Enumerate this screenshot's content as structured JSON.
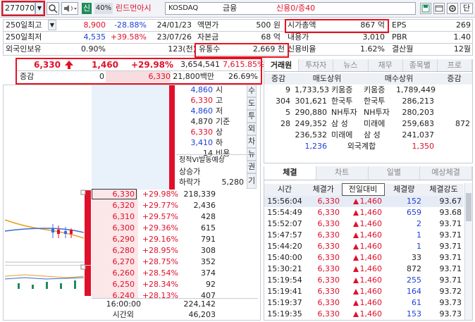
{
  "toolbar": {
    "code": "277070",
    "brand_tag": "신",
    "ratio": "40%",
    "name": "린드먼아시",
    "market": "KOSDAQ",
    "sector": "금융",
    "credit": "신용0/증40",
    "single": "단"
  },
  "info": {
    "r1": {
      "l1": "250일최고",
      "v1": "8,900",
      "p1": "-28.88%",
      "d1": "24/01/23",
      "l2": "액면가",
      "v2": "500 원",
      "l3": "시가총액",
      "v3": "867 억",
      "l4": "EPS",
      "v4": "269"
    },
    "r2": {
      "l1": "250일최저",
      "v1": "4,535",
      "p1": "+39.58%",
      "d1": "23/07/26",
      "l2": "자본금",
      "v2": "68 억",
      "l3": "내용가",
      "v3": "3,010",
      "l4": "PBR",
      "v4": "1.40"
    },
    "r3": {
      "l1": "외국인보유",
      "v1": "0.90%",
      "p1": "123(천)",
      "l2": "유통수",
      "v2": "2,669 천",
      "l3": "신용비율",
      "v3": "1.62%",
      "l4": "결산월",
      "v4": "12월"
    }
  },
  "price": {
    "current": "6,330",
    "change": "1,460",
    "rate": "+29.98%",
    "volume": "3,654,541",
    "vol_rate": "7,615.85%",
    "cmp_label": "증감",
    "cmp_val": "0",
    "cmp_price": "6,330",
    "amount": "21,800백만",
    "turnover": "26.69%"
  },
  "summary": [
    {
      "val": "4,860",
      "label": "시",
      "color": "blue"
    },
    {
      "val": "6,330",
      "label": "고",
      "color": "red"
    },
    {
      "val": "4,860",
      "label": "저",
      "color": "blue"
    },
    {
      "val": "4,870",
      "label": "기준",
      "color": "black"
    },
    {
      "val": "6,330",
      "label": "상",
      "color": "red"
    },
    {
      "val": "3,410",
      "label": "하",
      "color": "blue"
    },
    {
      "val": "14",
      "label": "비용",
      "color": "black"
    }
  ],
  "static_vi": {
    "title": "정적VI발동예상",
    "upper_label": "상승가",
    "lower_label": "하락가",
    "lower_val": "5,280"
  },
  "vbuttons": [
    "수",
    "도",
    "투",
    "외",
    "차",
    "뉴",
    "권",
    "기"
  ],
  "book": {
    "asks": [
      {
        "price": "6,330",
        "rate": "+29.98%",
        "qty": "218,339"
      },
      {
        "price": "6,320",
        "rate": "+29.77%",
        "qty": "2,436"
      },
      {
        "price": "6,310",
        "rate": "+29.57%",
        "qty": "428"
      },
      {
        "price": "6,300",
        "rate": "+29.36%",
        "qty": "615"
      },
      {
        "price": "6,290",
        "rate": "+29.16%",
        "qty": "791"
      },
      {
        "price": "6,280",
        "rate": "+28.95%",
        "qty": "308"
      },
      {
        "price": "6,270",
        "rate": "+28.75%",
        "qty": "352"
      },
      {
        "price": "6,260",
        "rate": "+28.54%",
        "qty": "374"
      },
      {
        "price": "6,250",
        "rate": "+28.34%",
        "qty": "92"
      },
      {
        "price": "6,240",
        "rate": "+28.13%",
        "qty": "407"
      }
    ],
    "foot": {
      "time": "16:00:00",
      "time_qty": "224,142",
      "after_label": "시간외",
      "after_qty": "46,203"
    }
  },
  "broker": {
    "tabs": [
      "거래원",
      "투자자",
      "뉴스",
      "재무",
      "종목별",
      "프로"
    ],
    "header": [
      "증감",
      "매도상위",
      "매수상위",
      "증감"
    ],
    "rows": [
      {
        "d1": "9",
        "sv": "1,733,531",
        "sn": "키움증",
        "bn": "키움증",
        "bv": "1,789,449",
        "d2": ""
      },
      {
        "d1": "304",
        "sv": "301,621",
        "sn": "한국투",
        "bn": "한국투",
        "bv": "286,213",
        "d2": ""
      },
      {
        "d1": "5",
        "sv": "290,880",
        "sn": "NH투자",
        "bn": "NH투자",
        "bv": "280,203",
        "d2": ""
      },
      {
        "d1": "28",
        "sv": "249,352",
        "sn": "삼  성",
        "bn": "미래에",
        "bv": "259,683",
        "d2": "872"
      },
      {
        "d1": "",
        "sv": "236,532",
        "sn": "미래에",
        "bn": "삼  성",
        "bv": "241,037",
        "d2": ""
      }
    ],
    "foreign": {
      "left": "1,236",
      "label": "외국계합",
      "right": "1,350"
    }
  },
  "trades": {
    "tabs": [
      "체결",
      "차트",
      "일별",
      "예상체결"
    ],
    "header": [
      "시간",
      "체결가",
      "전일대비",
      "체결량",
      "체결강도"
    ],
    "rows": [
      {
        "t": "15:56:04",
        "p": "6,330",
        "d": "1,460",
        "q": "152",
        "s": "93.67",
        "qc": "blue"
      },
      {
        "t": "15:54:49",
        "p": "6,330",
        "d": "1,460",
        "q": "659",
        "s": "93.68",
        "qc": "blue"
      },
      {
        "t": "15:52:07",
        "p": "6,330",
        "d": "1,460",
        "q": "2",
        "s": "93.71",
        "qc": "blue"
      },
      {
        "t": "15:47:57",
        "p": "6,330",
        "d": "1,460",
        "q": "1",
        "s": "93.71",
        "qc": "blue"
      },
      {
        "t": "15:44:20",
        "p": "6,330",
        "d": "1,460",
        "q": "1",
        "s": "93.71",
        "qc": "blue"
      },
      {
        "t": "15:40:00",
        "p": "6,330",
        "d": "1,460",
        "q": "33",
        "s": "93.71",
        "qc": "black"
      },
      {
        "t": "15:30:21",
        "p": "6,330",
        "d": "1,460",
        "q": "872",
        "s": "93.71",
        "qc": "black"
      },
      {
        "t": "15:19:54",
        "p": "6,330",
        "d": "1,460",
        "q": "255",
        "s": "93.71",
        "qc": "blue"
      },
      {
        "t": "15:19:41",
        "p": "6,330",
        "d": "1,460",
        "q": "164",
        "s": "93.72",
        "qc": "blue"
      },
      {
        "t": "15:19:37",
        "p": "6,330",
        "d": "1,460",
        "q": "61",
        "s": "93.73",
        "qc": "blue"
      },
      {
        "t": "15:19:35",
        "p": "6,330",
        "d": "1,460",
        "q": "153",
        "s": "93.73",
        "qc": "blue"
      }
    ]
  },
  "colors": {
    "up": "#e0102a",
    "down": "#1e40d8",
    "highlight": "#e8121f",
    "panel_red": "#f4ccd0",
    "panel_blue": "#cfe0f4"
  }
}
